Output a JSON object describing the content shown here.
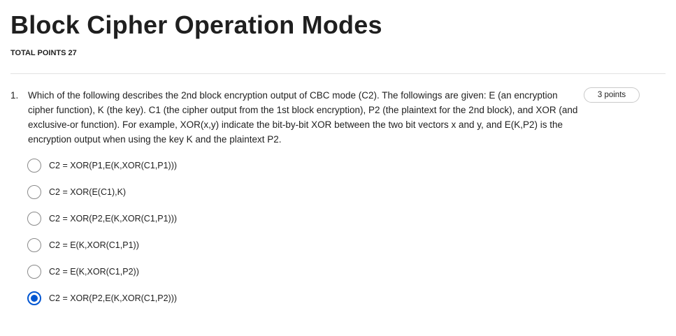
{
  "page": {
    "title": "Block Cipher Operation Modes",
    "total_points": "TOTAL POINTS 27"
  },
  "question": {
    "number": "1.",
    "text": "Which of the following describes the 2nd block encryption output of CBC mode (C2). The followings are given: E (an encryption cipher function), K (the key). C1 (the cipher output from the 1st block encryption), P2 (the plaintext for the 2nd block), and XOR (and exclusive-or function). For example, XOR(x,y) indicate the bit-by-bit XOR between the two bit vectors x and y, and E(K,P2) is the encryption output when using the key K and the plaintext P2.",
    "points": "3 points",
    "options": [
      {
        "label": "C2 = XOR(P1,E(K,XOR(C1,P1)))",
        "selected": false
      },
      {
        "label": "C2 = XOR(E(C1),K)",
        "selected": false
      },
      {
        "label": "C2 = XOR(P2,E(K,XOR(C1,P1)))",
        "selected": false
      },
      {
        "label": "C2 = E(K,XOR(C1,P1))",
        "selected": false
      },
      {
        "label": "C2 = E(K,XOR(C1,P2))",
        "selected": false
      },
      {
        "label": "C2 = XOR(P2,E(K,XOR(C1,P2)))",
        "selected": true
      }
    ]
  },
  "colors": {
    "accent": "#0056d2",
    "text": "#1f1f1f",
    "divider": "#e1e1e1"
  }
}
